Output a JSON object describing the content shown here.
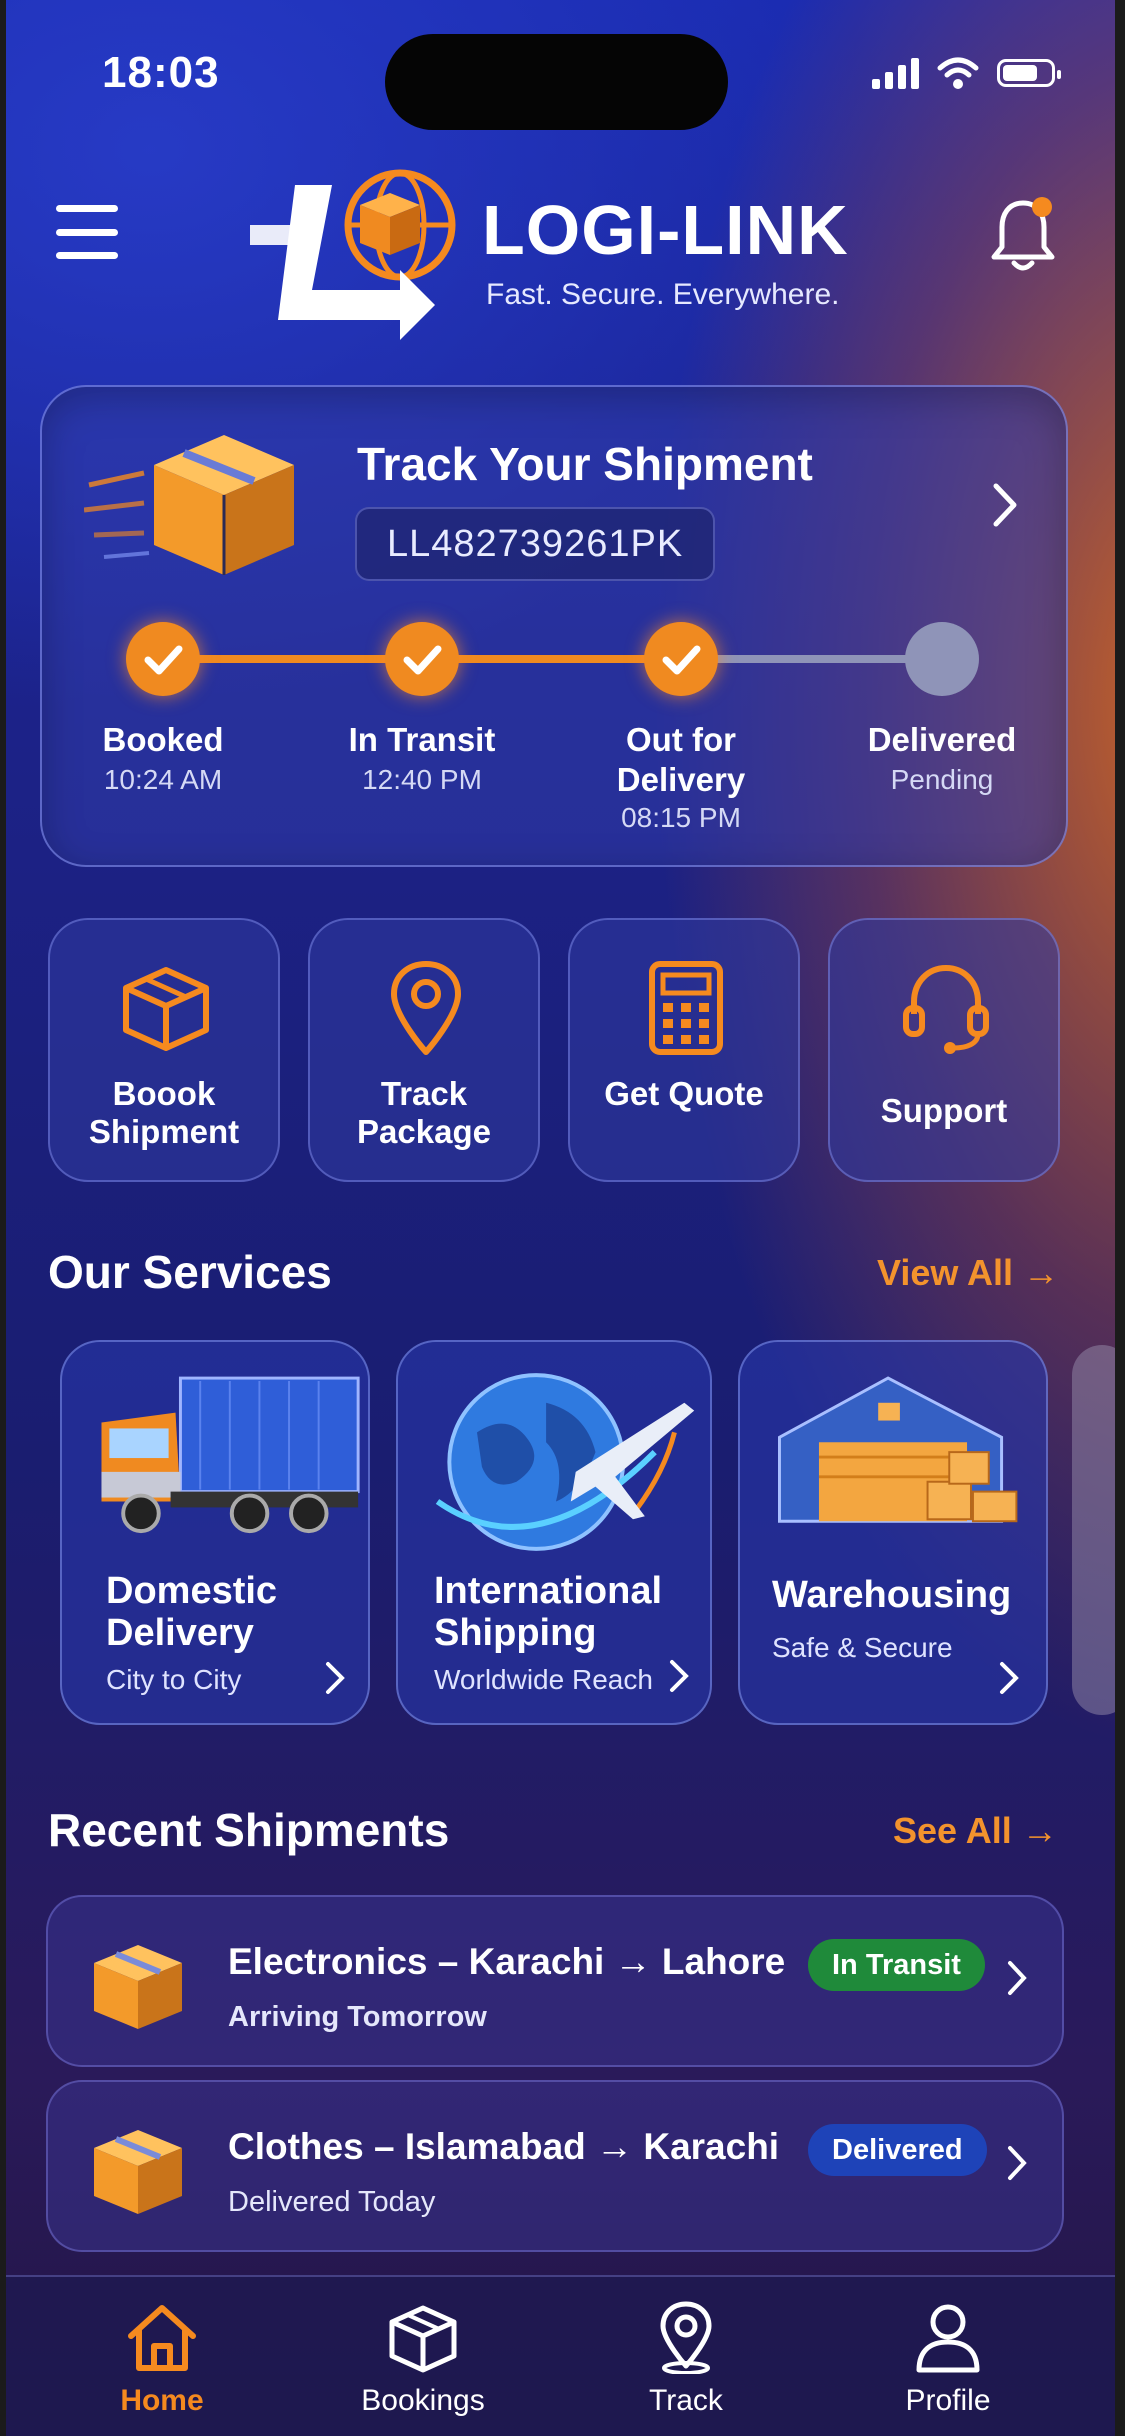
{
  "status": {
    "time": "18:03"
  },
  "header": {
    "brand": "LOGI-LINK",
    "tagline": "Fast. Secure. Everywhere."
  },
  "tracking": {
    "title": "Track Your Shipment",
    "number": "LL482739261PK",
    "steps": [
      {
        "label": "Booked",
        "time": "10:24 AM",
        "done": true
      },
      {
        "label": "In Transit",
        "time": "12:40 PM",
        "done": true
      },
      {
        "label": "Out for Delivery",
        "time": "08:15 PM",
        "done": true
      },
      {
        "label": "Delivered",
        "time": "Pending",
        "done": false
      }
    ]
  },
  "quick_actions": [
    {
      "label": "Boook Shipment",
      "icon": "box-icon"
    },
    {
      "label": "Track Package",
      "icon": "location-pin-icon"
    },
    {
      "label": "Get Quote",
      "icon": "calculator-icon"
    },
    {
      "label": "Support",
      "icon": "headset-icon"
    }
  ],
  "services": {
    "title": "Our Services",
    "link": "View All →",
    "items": [
      {
        "title": "Domestic Delivery",
        "subtitle": "City to City",
        "image": "truck-image"
      },
      {
        "title": "International Shipping",
        "subtitle": "Worldwide Reach",
        "image": "globe-plane-image"
      },
      {
        "title": "Warehousing",
        "subtitle": "Safe & Secure",
        "image": "warehouse-image"
      }
    ]
  },
  "recent": {
    "title": "Recent Shipments",
    "link": "See All →",
    "items": [
      {
        "title": "Electronics – Karachi → Lahore",
        "subtitle": "Arriving Tomorrow",
        "status": "In Transit",
        "status_color": "#1f8a3a"
      },
      {
        "title": "Clothes – Islamabad → Karachi",
        "subtitle": "Delivered Today",
        "status": "Delivered",
        "status_color": "#1e43b8"
      }
    ]
  },
  "tabs": [
    {
      "label": "Home",
      "icon": "home-icon",
      "active": true
    },
    {
      "label": "Bookings",
      "icon": "package-icon",
      "active": false
    },
    {
      "label": "Track",
      "icon": "location-pin-icon",
      "active": false
    },
    {
      "label": "Profile",
      "icon": "user-icon",
      "active": false
    }
  ],
  "colors": {
    "accent": "#f58a1f",
    "primary": "#1c2288"
  }
}
